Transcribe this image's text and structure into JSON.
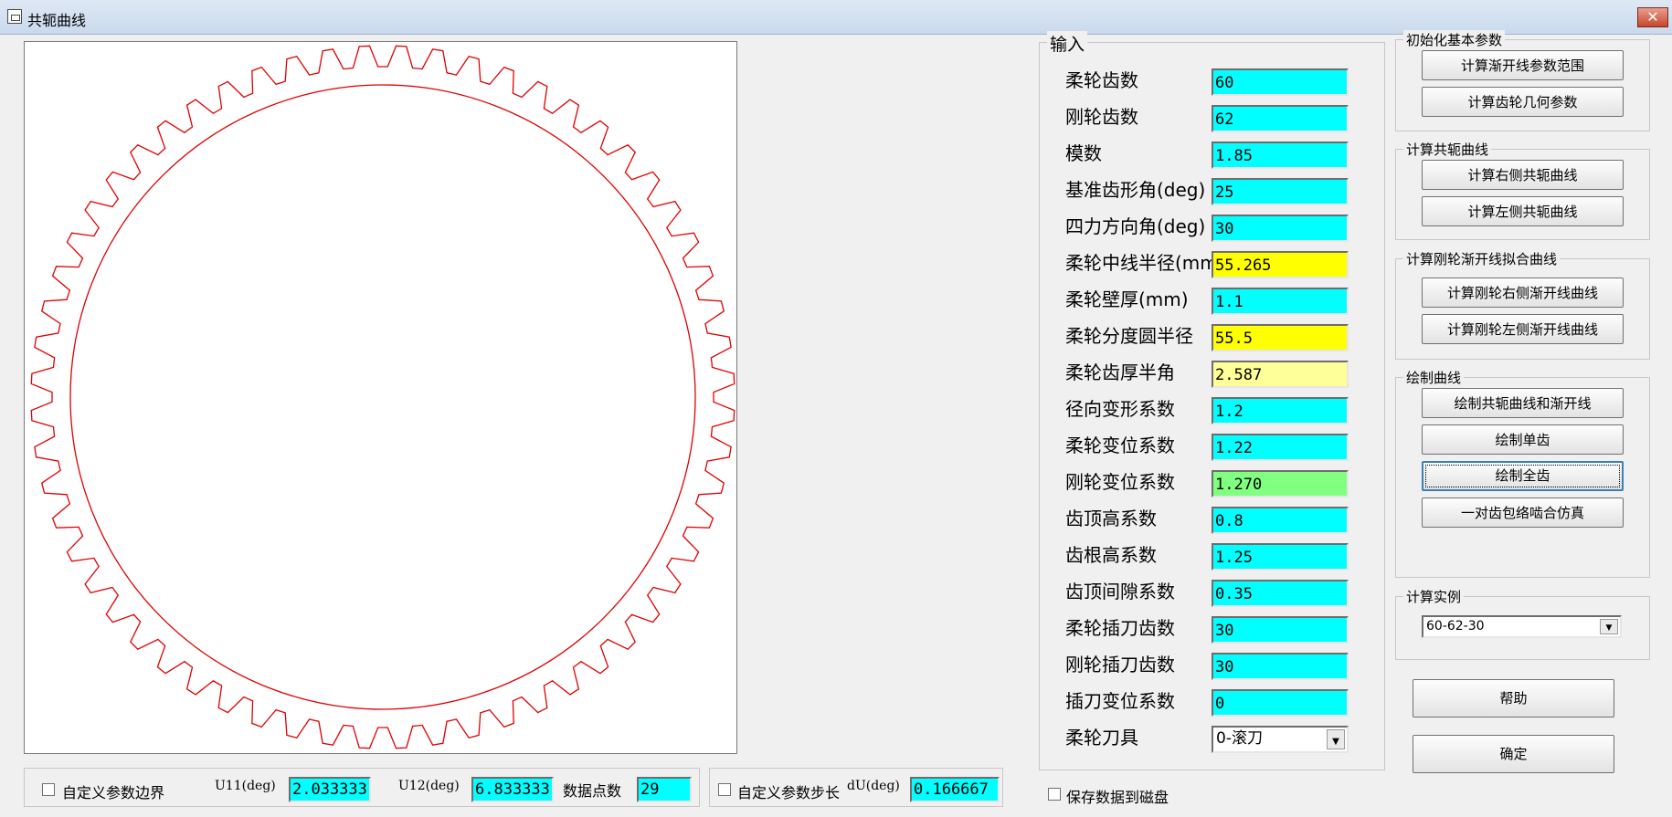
{
  "window": {
    "title": "共轭曲线",
    "close": "✕"
  },
  "colors": {
    "cyan": "#00ffff",
    "yellow": "#ffff00",
    "light_yellow": "#ffff99",
    "green": "#80ff80",
    "curve": "#e00000"
  },
  "canvas": {
    "teeth": 60
  },
  "input_group": {
    "title": "输入",
    "rows": [
      {
        "label": "柔轮齿数",
        "value": "60",
        "color": "#00ffff"
      },
      {
        "label": "刚轮齿数",
        "value": "62",
        "color": "#00ffff"
      },
      {
        "label": "模数",
        "value": "1.85",
        "color": "#00ffff"
      },
      {
        "label": "基准齿形角(deg)",
        "value": "25",
        "color": "#00ffff"
      },
      {
        "label": "四力方向角(deg)",
        "value": "30",
        "color": "#00ffff"
      },
      {
        "label": "柔轮中线半径(mm)",
        "value": "55.265",
        "color": "#ffff00"
      },
      {
        "label": "柔轮壁厚(mm)",
        "value": "1.1",
        "color": "#00ffff"
      },
      {
        "label": "柔轮分度圆半径",
        "value": "55.5",
        "color": "#ffff00"
      },
      {
        "label": "柔轮齿厚半角",
        "value": "2.587",
        "color": "#ffff99"
      },
      {
        "label": "径向变形系数",
        "value": "1.2",
        "color": "#00ffff"
      },
      {
        "label": "柔轮变位系数",
        "value": "1.22",
        "color": "#00ffff"
      },
      {
        "label": "刚轮变位系数",
        "value": "1.270",
        "color": "#80ff80"
      },
      {
        "label": "齿顶高系数",
        "value": "0.8",
        "color": "#00ffff"
      },
      {
        "label": "齿根高系数",
        "value": "1.25",
        "color": "#00ffff"
      },
      {
        "label": "齿顶间隙系数",
        "value": "0.35",
        "color": "#00ffff"
      },
      {
        "label": "柔轮插刀齿数",
        "value": "30",
        "color": "#00ffff"
      },
      {
        "label": "刚轮插刀齿数",
        "value": "30",
        "color": "#00ffff"
      },
      {
        "label": "插刀变位系数",
        "value": "0",
        "color": "#00ffff"
      }
    ],
    "tool_label": "柔轮刀具",
    "tool_value": "0-滚刀"
  },
  "init_group": {
    "title": "初始化基本参数",
    "btn1": "计算渐开线参数范围",
    "btn2": "计算齿轮几何参数"
  },
  "conj_group": {
    "title": "计算共轭曲线",
    "btn1": "计算右侧共轭曲线",
    "btn2": "计算左侧共轭曲线"
  },
  "fit_group": {
    "title": "计算刚轮渐开线拟合曲线",
    "btn1": "计算刚轮右侧渐开线曲线",
    "btn2": "计算刚轮左侧渐开线曲线"
  },
  "draw_group": {
    "title": "绘制曲线",
    "btn1": "绘制共轭曲线和渐开线",
    "btn2": "绘制单齿",
    "btn3": "绘制全齿",
    "btn4": "一对齿包络啮合仿真"
  },
  "example_group": {
    "title": "计算实例",
    "value": "60-62-30"
  },
  "help_button": "帮助",
  "ok_button": "确定",
  "bottom": {
    "custom_bounds": "自定义参数边界",
    "u11_label": "U11(deg)",
    "u11_value": "2.033333",
    "u12_label": "U12(deg)",
    "u12_value": "6.833333",
    "points_label": "数据点数",
    "points_value": "29",
    "custom_step": "自定义参数步长",
    "du_label": "dU(deg)",
    "du_value": "0.166667",
    "save_label": "保存数据到磁盘"
  }
}
